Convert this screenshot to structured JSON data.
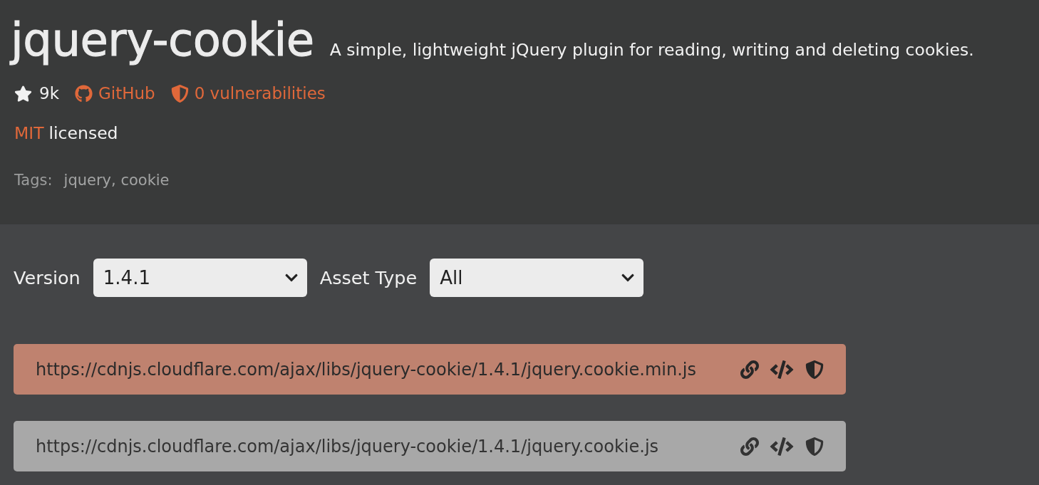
{
  "header": {
    "title": "jquery-cookie",
    "description": "A simple, lightweight jQuery plugin for reading, writing and deleting cookies.",
    "star_count": "9k",
    "github_link": "GitHub",
    "vulnerabilities_link": "0 vulnerabilities",
    "license": {
      "name": "MIT",
      "text": "licensed"
    },
    "tags": {
      "label": "Tags:",
      "value": "jquery, cookie"
    }
  },
  "filters": [
    {
      "label": "Version",
      "value": "1.4.1"
    },
    {
      "label": "Asset Type",
      "value": "All"
    }
  ],
  "assets": [
    {
      "url": "https://cdnjs.cloudflare.com/ajax/libs/jquery-cookie/1.4.1/jquery.cookie.min.js",
      "highlighted": true
    },
    {
      "url": "https://cdnjs.cloudflare.com/ajax/libs/jquery-cookie/1.4.1/jquery.cookie.js",
      "highlighted": false
    }
  ]
}
